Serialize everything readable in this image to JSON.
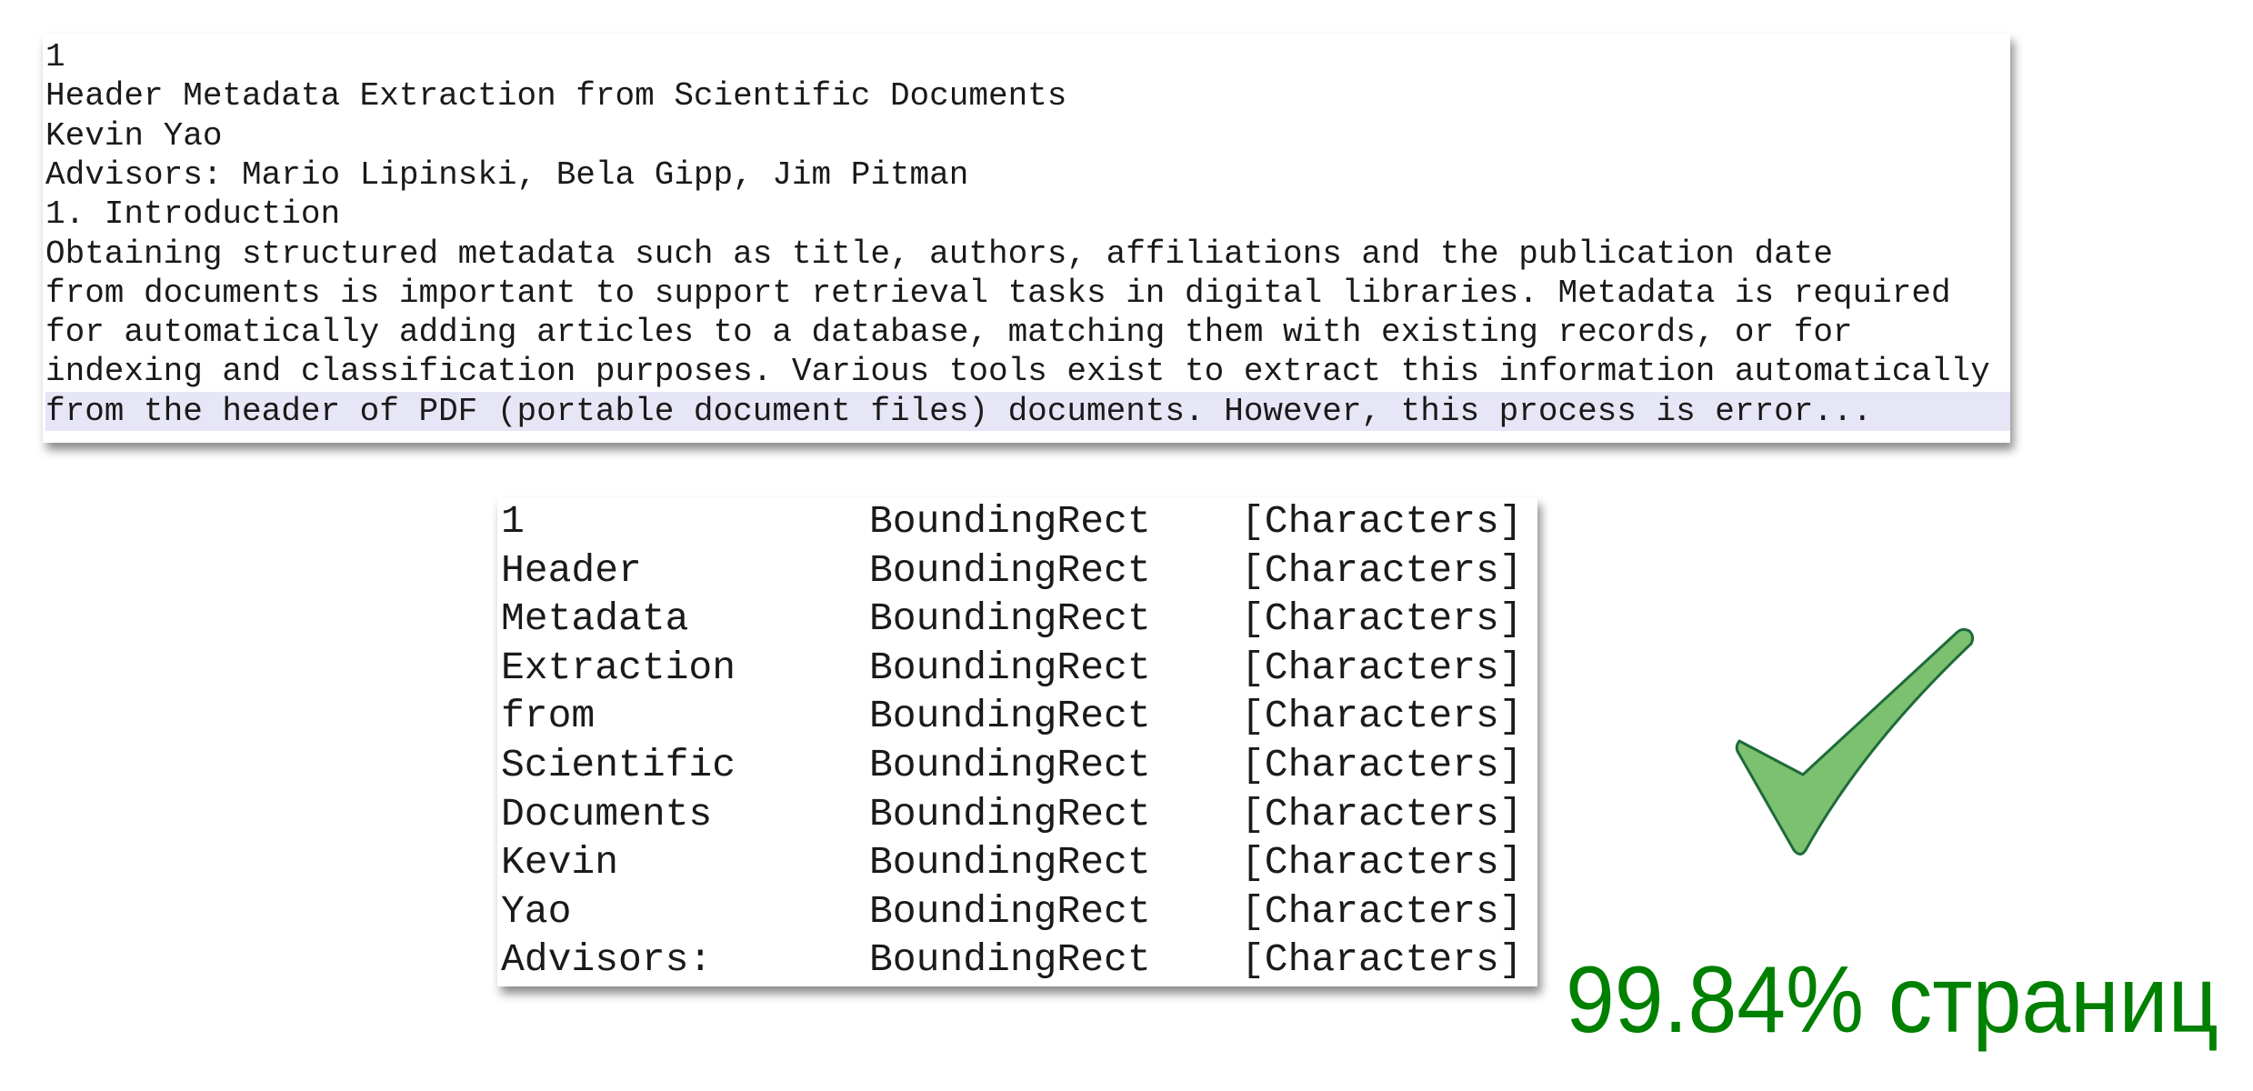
{
  "text_view": {
    "lines": [
      "1",
      "Header Metadata Extraction from Scientific Documents",
      "Kevin Yao",
      "Advisors: Mario Lipinski, Bela Gipp, Jim Pitman",
      "1. Introduction",
      "Obtaining structured metadata such as title, authors, affiliations and the publication date",
      "from documents is important to support retrieval tasks in digital libraries. Metadata is required",
      "for automatically adding articles to a database, matching them with existing records, or for",
      "indexing and classification purposes. Various tools exist to extract this information automatically",
      "from the header of PDF (portable document files) documents. However, this process is error..."
    ],
    "highlighted_line_index": 9
  },
  "token_table": {
    "rows": [
      [
        "1",
        "BoundingRect",
        "[Characters]"
      ],
      [
        "Header",
        "BoundingRect",
        "[Characters]"
      ],
      [
        "Metadata",
        "BoundingRect",
        "[Characters]"
      ],
      [
        "Extraction",
        "BoundingRect",
        "[Characters]"
      ],
      [
        "from",
        "BoundingRect",
        "[Characters]"
      ],
      [
        "Scientific",
        "BoundingRect",
        "[Characters]"
      ],
      [
        "Documents",
        "BoundingRect",
        "[Characters]"
      ],
      [
        "Kevin",
        "BoundingRect",
        "[Characters]"
      ],
      [
        "Yao",
        "BoundingRect",
        "[Characters]"
      ],
      [
        "Advisors:",
        "BoundingRect",
        "[Characters]"
      ]
    ]
  },
  "result": {
    "icon": "checkmark-icon",
    "text": "99.84% страниц",
    "text_color": "#008000",
    "icon_fill": "#7BC16F",
    "icon_stroke": "#1E6B3A"
  }
}
